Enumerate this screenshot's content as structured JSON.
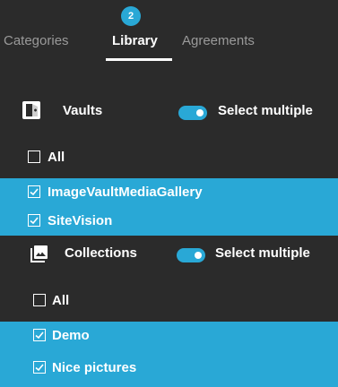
{
  "tabs": {
    "items": [
      {
        "label": "Categories",
        "active": false
      },
      {
        "label": "Library",
        "active": true,
        "badge": "2"
      },
      {
        "label": "Agreements",
        "active": false
      }
    ]
  },
  "vaults": {
    "title": "Vaults",
    "icon": "vault-icon",
    "toggle_label": "Select multiple",
    "toggle_on": true,
    "all_label": "All",
    "items": [
      {
        "label": "ImageVaultMediaGallery",
        "checked": true
      },
      {
        "label": "SiteVision",
        "checked": true
      }
    ]
  },
  "collections": {
    "title": "Collections",
    "icon": "image-gallery-icon",
    "toggle_label": "Select multiple",
    "toggle_on": true,
    "all_label": "All",
    "items": [
      {
        "label": "Demo",
        "checked": true
      },
      {
        "label": "Nice pictures",
        "checked": true
      }
    ]
  },
  "colors": {
    "background": "#2b2b2b",
    "accent": "#29a8d6",
    "inactive_text": "#9a9a9a",
    "text": "#ffffff"
  }
}
